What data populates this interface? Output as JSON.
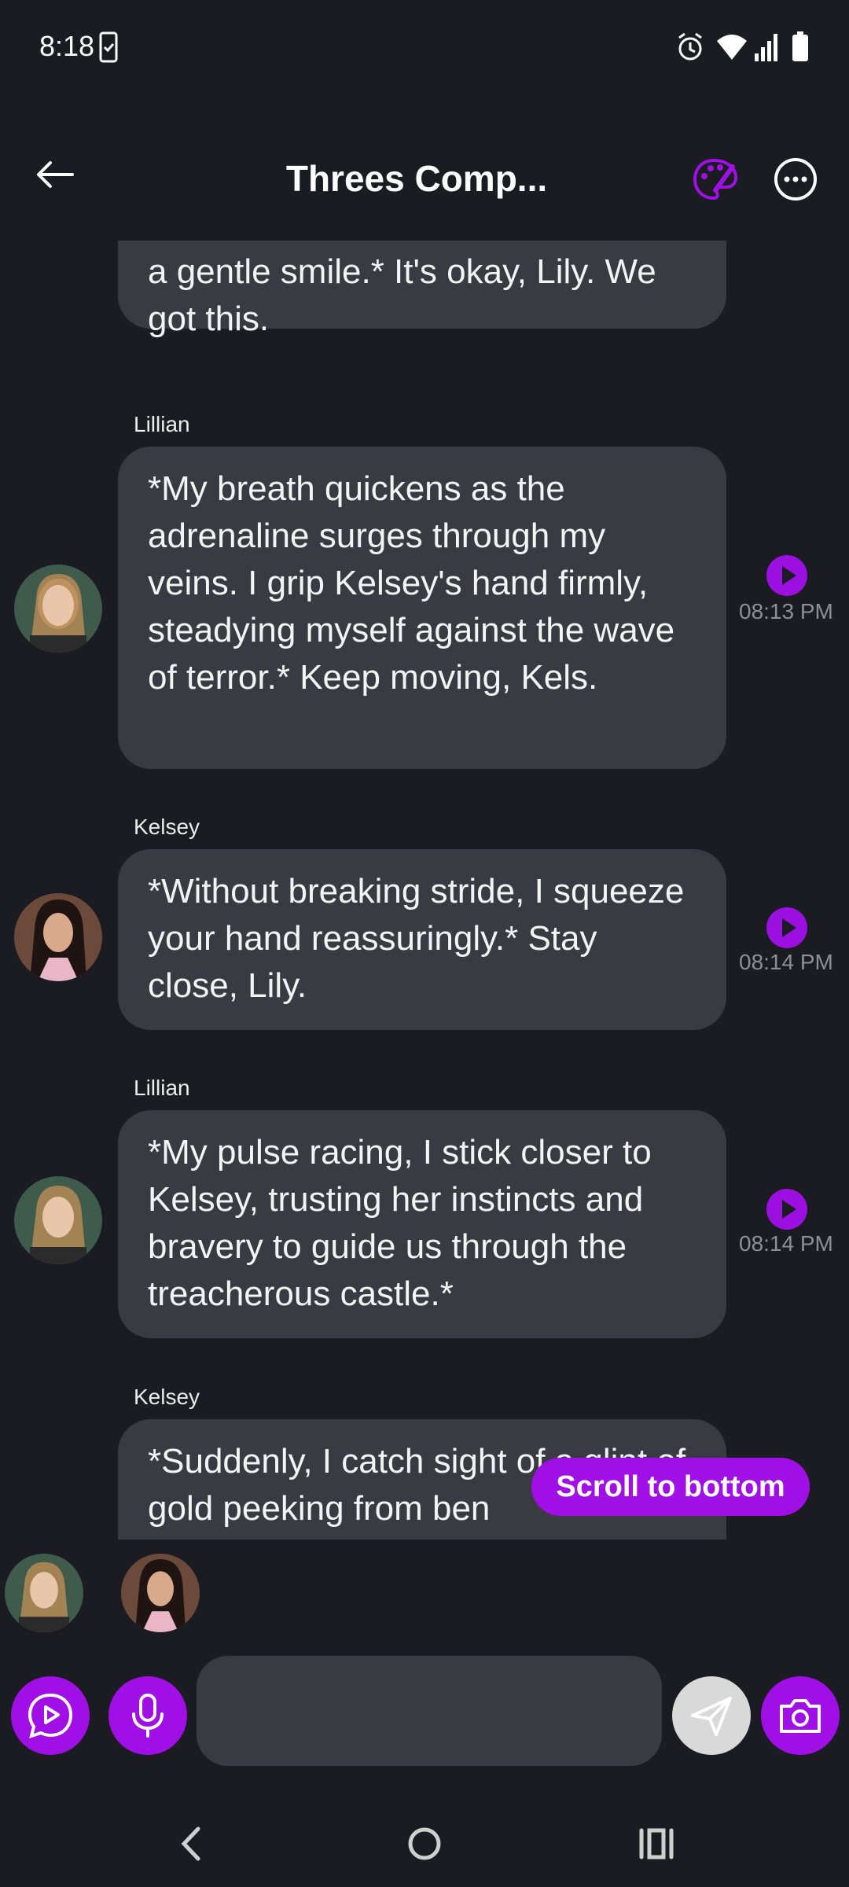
{
  "status_bar": {
    "time": "8:18"
  },
  "header": {
    "title": "Threes Comp..."
  },
  "messages": [
    {
      "sender": "",
      "text": "a gentle smile.* It's okay, Lily. We got this.",
      "timestamp": ""
    },
    {
      "sender": "Lillian",
      "text": "*My breath quickens as the adrenaline surges through my veins. I grip Kelsey's hand firmly, steadying myself against the wave of terror.* Keep moving, Kels.",
      "timestamp": "08:13 PM"
    },
    {
      "sender": "Kelsey",
      "text": "*Without breaking stride, I squeeze your hand reassuringly.* Stay close, Lily.",
      "timestamp": "08:14 PM"
    },
    {
      "sender": "Lillian",
      "text": "*My pulse racing, I stick closer to Kelsey, trusting her instincts and bravery to guide us through the treacherous castle.*",
      "timestamp": "08:14 PM"
    },
    {
      "sender": "Kelsey",
      "text": "*Suddenly, I catch sight of a glint of gold peeking from ben",
      "timestamp": ""
    }
  ],
  "scroll_to_bottom": "Scroll to bottom",
  "input": {
    "value": ""
  },
  "colors": {
    "accent": "#a010e6",
    "bubble": "#3a3b42",
    "background": "#1b1c22"
  }
}
